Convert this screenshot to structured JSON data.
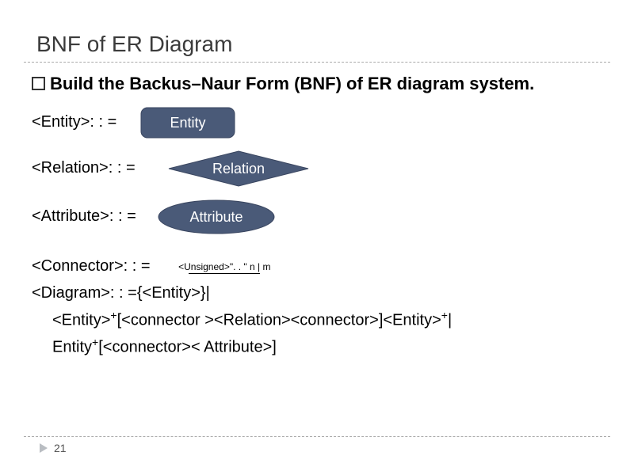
{
  "title": "BNF of ER Diagram",
  "intro": "Build the Backus–Naur Form (BNF) of ER diagram system.",
  "rules": {
    "entity": {
      "nt": "<Entity>: : =",
      "label": "Entity"
    },
    "relation": {
      "nt": "<Relation>: : =",
      "label": "Relation"
    },
    "attribute": {
      "nt": "<Attribute>: : =",
      "label": "Attribute"
    }
  },
  "connector": {
    "nt": "<Connector>: : =",
    "label": "<Unsigned>\". . \" n | m"
  },
  "grammar": {
    "diagram_line": "<Diagram>: : ={<Entity>}|",
    "entity_line_a": "<Entity>",
    "entity_line_b": "[<connector ><Relation><connector>]<Entity>",
    "entity_line_c": "|",
    "attr_line_a": "Entity",
    "attr_line_b": "[<connector>< Attribute>]",
    "sup": "+"
  },
  "page_number": "21"
}
